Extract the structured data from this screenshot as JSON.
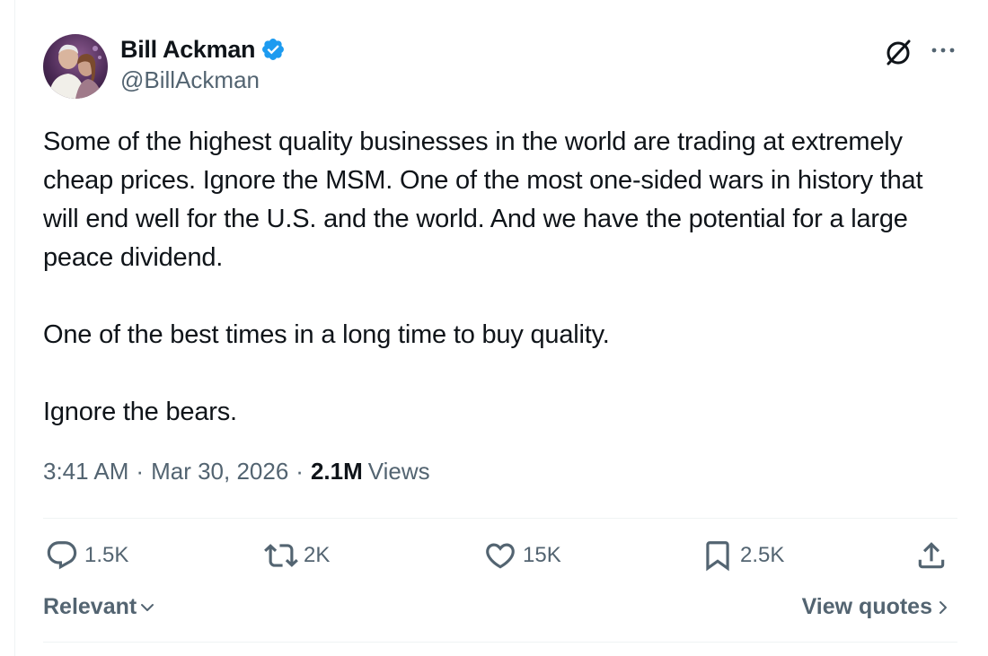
{
  "author": {
    "name": "Bill Ackman",
    "handle": "@BillAckman",
    "verified": true,
    "verified_color": "#1d9bf0"
  },
  "tweet": {
    "paragraphs": [
      "Some of the highest quality businesses in the world are trading at extremely cheap prices. Ignore the MSM. One of the most one-sided wars in history that will end well for the U.S. and the world. And we have the potential for a large peace dividend.",
      "One of the best times in a long time to buy quality.",
      "Ignore the bears."
    ],
    "time": "3:41 AM",
    "date": "Mar 30, 2026",
    "views_count": "2.1M",
    "views_label": "Views",
    "separator": "·"
  },
  "actions": {
    "replies": "1.5K",
    "reposts": "2K",
    "likes": "15K",
    "bookmarks": "2.5K"
  },
  "footer": {
    "sort_label": "Relevant",
    "quotes_label": "View quotes"
  },
  "icons": {
    "header": [
      "grok-icon",
      "more-options-icon"
    ],
    "actions": [
      "reply-icon",
      "repost-icon",
      "like-icon",
      "bookmark-icon",
      "share-icon"
    ]
  }
}
